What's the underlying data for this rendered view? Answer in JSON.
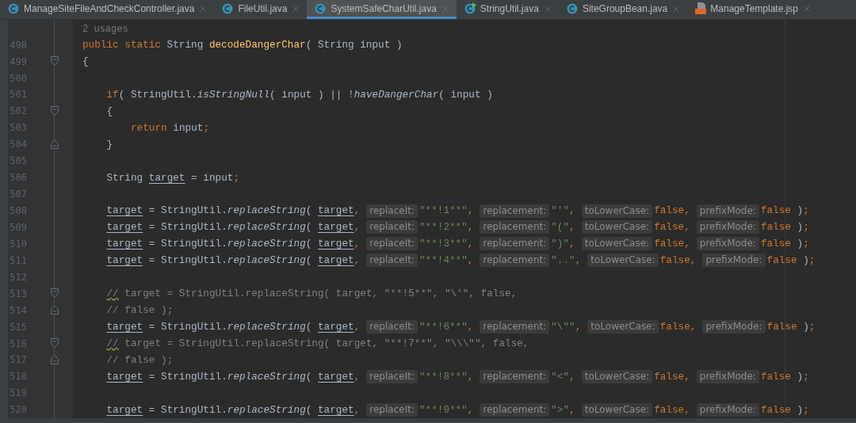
{
  "tabs": [
    {
      "label": "ManageSiteFileAndCheckController.java",
      "kind": "class",
      "selected": false
    },
    {
      "label": "FileUtil.java",
      "kind": "class",
      "selected": false
    },
    {
      "label": "SystemSafeCharUtil.java",
      "kind": "class",
      "selected": true
    },
    {
      "label": "StringUtil.java",
      "kind": "runnable",
      "selected": false
    },
    {
      "label": "SiteGroupBean.java",
      "kind": "class",
      "selected": false
    },
    {
      "label": "ManageTemplate.jsp",
      "kind": "jsp",
      "selected": false
    }
  ],
  "usages": "2 usages",
  "lines": [
    {
      "number": "498",
      "kind": "member",
      "fold_start": false,
      "fold_end": false,
      "tokens": [
        {
          "kind": "keyword",
          "text": "public static "
        },
        {
          "kind": "plain",
          "text": "String "
        },
        {
          "kind": "declaration",
          "text": "decodeDangerChar"
        },
        {
          "kind": "plain",
          "text": "( String input )"
        }
      ]
    },
    {
      "number": "499",
      "kind": "member",
      "fold_start": true,
      "fold_end": false,
      "tokens": [
        {
          "kind": "plain",
          "text": "{"
        }
      ]
    },
    {
      "number": "500",
      "kind": "member",
      "fold_start": false,
      "fold_end": false
    },
    {
      "number": "501",
      "kind": "statement",
      "fold_start": false,
      "fold_end": false,
      "tokens": [
        {
          "kind": "keyword",
          "text": "if"
        },
        {
          "kind": "plain",
          "text": "( StringUtil."
        },
        {
          "kind": "call",
          "text": "isStringNull"
        },
        {
          "kind": "plain",
          "text": "( input ) || !"
        },
        {
          "kind": "call",
          "text": "haveDangerChar"
        },
        {
          "kind": "plain",
          "text": "( input )"
        }
      ]
    },
    {
      "number": "502",
      "kind": "statement",
      "fold_start": true,
      "fold_end": false,
      "tokens": [
        {
          "kind": "plain",
          "text": "{"
        }
      ]
    },
    {
      "number": "503",
      "kind": "inner",
      "fold_start": false,
      "fold_end": false,
      "tokens": [
        {
          "kind": "keyword",
          "text": "return "
        },
        {
          "kind": "plain",
          "text": "input"
        },
        {
          "kind": "keyword",
          "text": ";"
        }
      ]
    },
    {
      "number": "504",
      "kind": "statement",
      "fold_start": false,
      "fold_end": true,
      "tokens": [
        {
          "kind": "plain",
          "text": "}"
        }
      ]
    },
    {
      "number": "505",
      "kind": "member",
      "fold_start": false,
      "fold_end": false
    },
    {
      "number": "506",
      "kind": "statement",
      "fold_start": false,
      "fold_end": false,
      "tokens": [
        {
          "kind": "plain",
          "text": "String "
        },
        {
          "kind": "variable",
          "text": "target"
        },
        {
          "kind": "plain",
          "text": " = input"
        },
        {
          "kind": "keyword",
          "text": ";"
        }
      ]
    },
    {
      "number": "507",
      "kind": "member",
      "fold_start": false,
      "fold_end": false
    },
    {
      "number": "508",
      "kind": "statement",
      "fold_start": false,
      "fold_end": false,
      "tokens": [
        {
          "kind": "variable",
          "text": "target"
        },
        {
          "kind": "plain",
          "text": " = StringUtil."
        },
        {
          "kind": "call",
          "text": "replaceString"
        },
        {
          "kind": "plain",
          "text": "( "
        },
        {
          "kind": "variable",
          "text": "target"
        },
        {
          "kind": "keyword",
          "text": ","
        },
        {
          "kind": "hint",
          "text": "replaceIt:"
        },
        {
          "kind": "string",
          "text": "\"**!1**\""
        },
        {
          "kind": "keyword",
          "text": ","
        },
        {
          "kind": "hint",
          "text": "replacement:"
        },
        {
          "kind": "string",
          "text": "\"'\""
        },
        {
          "kind": "keyword",
          "text": ","
        },
        {
          "kind": "hint",
          "text": "toLowerCase:"
        },
        {
          "kind": "keyword",
          "text": "false,"
        },
        {
          "kind": "hint",
          "text": "prefixMode:"
        },
        {
          "kind": "keyword",
          "text": "false"
        },
        {
          "kind": "plain",
          "text": " )"
        },
        {
          "kind": "keyword",
          "text": ";"
        }
      ]
    },
    {
      "number": "509",
      "kind": "statement",
      "fold_start": false,
      "fold_end": false,
      "tokens": [
        {
          "kind": "variable",
          "text": "target"
        },
        {
          "kind": "plain",
          "text": " = StringUtil."
        },
        {
          "kind": "call",
          "text": "replaceString"
        },
        {
          "kind": "plain",
          "text": "( "
        },
        {
          "kind": "variable",
          "text": "target"
        },
        {
          "kind": "keyword",
          "text": ","
        },
        {
          "kind": "hint",
          "text": "replaceIt:"
        },
        {
          "kind": "string",
          "text": "\"**!2**\""
        },
        {
          "kind": "keyword",
          "text": ","
        },
        {
          "kind": "hint",
          "text": "replacement:"
        },
        {
          "kind": "string",
          "text": "\"(\""
        },
        {
          "kind": "keyword",
          "text": ","
        },
        {
          "kind": "hint",
          "text": "toLowerCase:"
        },
        {
          "kind": "keyword",
          "text": "false,"
        },
        {
          "kind": "hint",
          "text": "prefixMode:"
        },
        {
          "kind": "keyword",
          "text": "false"
        },
        {
          "kind": "plain",
          "text": " )"
        },
        {
          "kind": "keyword",
          "text": ";"
        }
      ]
    },
    {
      "number": "510",
      "kind": "statement",
      "fold_start": false,
      "fold_end": false,
      "tokens": [
        {
          "kind": "variable",
          "text": "target"
        },
        {
          "kind": "plain",
          "text": " = StringUtil."
        },
        {
          "kind": "call",
          "text": "replaceString"
        },
        {
          "kind": "plain",
          "text": "( "
        },
        {
          "kind": "variable",
          "text": "target"
        },
        {
          "kind": "keyword",
          "text": ","
        },
        {
          "kind": "hint",
          "text": "replaceIt:"
        },
        {
          "kind": "string",
          "text": "\"**!3**\""
        },
        {
          "kind": "keyword",
          "text": ","
        },
        {
          "kind": "hint",
          "text": "replacement:"
        },
        {
          "kind": "string",
          "text": "\")\""
        },
        {
          "kind": "keyword",
          "text": ","
        },
        {
          "kind": "hint",
          "text": "toLowerCase:"
        },
        {
          "kind": "keyword",
          "text": "false,"
        },
        {
          "kind": "hint",
          "text": "prefixMode:"
        },
        {
          "kind": "keyword",
          "text": "false"
        },
        {
          "kind": "plain",
          "text": " )"
        },
        {
          "kind": "keyword",
          "text": ";"
        }
      ]
    },
    {
      "number": "511",
      "kind": "statement",
      "fold_start": false,
      "fold_end": false,
      "tokens": [
        {
          "kind": "variable",
          "text": "target"
        },
        {
          "kind": "plain",
          "text": " = StringUtil."
        },
        {
          "kind": "call",
          "text": "replaceString"
        },
        {
          "kind": "plain",
          "text": "( "
        },
        {
          "kind": "variable",
          "text": "target"
        },
        {
          "kind": "keyword",
          "text": ","
        },
        {
          "kind": "hint",
          "text": "replaceIt:"
        },
        {
          "kind": "string",
          "text": "\"**!4**\""
        },
        {
          "kind": "keyword",
          "text": ","
        },
        {
          "kind": "hint",
          "text": "replacement:"
        },
        {
          "kind": "string",
          "text": "\"..\""
        },
        {
          "kind": "keyword",
          "text": ","
        },
        {
          "kind": "hint",
          "text": "toLowerCase:"
        },
        {
          "kind": "keyword",
          "text": "false,"
        },
        {
          "kind": "hint",
          "text": "prefixMode:"
        },
        {
          "kind": "keyword",
          "text": "false"
        },
        {
          "kind": "plain",
          "text": " )"
        },
        {
          "kind": "keyword",
          "text": ";"
        }
      ]
    },
    {
      "number": "512",
      "kind": "member",
      "fold_start": false,
      "fold_end": false
    },
    {
      "number": "513",
      "kind": "statement",
      "fold_start": true,
      "fold_end": false,
      "tokens": [
        {
          "kind": "comment_marked",
          "text": "//"
        },
        {
          "kind": "comment",
          "text": " target = StringUtil.replaceString( target, \"**!5**\", \"\\'\", false,"
        }
      ]
    },
    {
      "number": "514",
      "kind": "statement",
      "fold_start": false,
      "fold_end": true,
      "tokens": [
        {
          "kind": "comment",
          "text": "// false );"
        }
      ]
    },
    {
      "number": "515",
      "kind": "statement",
      "fold_start": false,
      "fold_end": false,
      "tokens": [
        {
          "kind": "variable",
          "text": "target"
        },
        {
          "kind": "plain",
          "text": " = StringUtil."
        },
        {
          "kind": "call",
          "text": "replaceString"
        },
        {
          "kind": "plain",
          "text": "( "
        },
        {
          "kind": "variable",
          "text": "target"
        },
        {
          "kind": "keyword",
          "text": ","
        },
        {
          "kind": "hint",
          "text": "replaceIt:"
        },
        {
          "kind": "string",
          "text": "\"**!6**\""
        },
        {
          "kind": "keyword",
          "text": ","
        },
        {
          "kind": "hint",
          "text": "replacement:"
        },
        {
          "kind": "string",
          "text": "\"\\\"\""
        },
        {
          "kind": "keyword",
          "text": ","
        },
        {
          "kind": "hint",
          "text": "toLowerCase:"
        },
        {
          "kind": "keyword",
          "text": "false,"
        },
        {
          "kind": "hint",
          "text": "prefixMode:"
        },
        {
          "kind": "keyword",
          "text": "false"
        },
        {
          "kind": "plain",
          "text": " )"
        },
        {
          "kind": "keyword",
          "text": ";"
        }
      ]
    },
    {
      "number": "516",
      "kind": "statement",
      "fold_start": true,
      "fold_end": false,
      "tokens": [
        {
          "kind": "comment_marked",
          "text": "//"
        },
        {
          "kind": "comment",
          "text": " target = StringUtil.replaceString( target, \"**!7**\", \"\\\\\\\"\", false,"
        }
      ]
    },
    {
      "number": "517",
      "kind": "statement",
      "fold_start": false,
      "fold_end": true,
      "tokens": [
        {
          "kind": "comment",
          "text": "// false );"
        }
      ]
    },
    {
      "number": "518",
      "kind": "statement",
      "fold_start": false,
      "fold_end": false,
      "tokens": [
        {
          "kind": "variable",
          "text": "target"
        },
        {
          "kind": "plain",
          "text": " = StringUtil."
        },
        {
          "kind": "call",
          "text": "replaceString"
        },
        {
          "kind": "plain",
          "text": "( "
        },
        {
          "kind": "variable",
          "text": "target"
        },
        {
          "kind": "keyword",
          "text": ","
        },
        {
          "kind": "hint",
          "text": "replaceIt:"
        },
        {
          "kind": "string",
          "text": "\"**!8**\""
        },
        {
          "kind": "keyword",
          "text": ","
        },
        {
          "kind": "hint",
          "text": "replacement:"
        },
        {
          "kind": "string",
          "text": "\"<\""
        },
        {
          "kind": "keyword",
          "text": ","
        },
        {
          "kind": "hint",
          "text": "toLowerCase:"
        },
        {
          "kind": "keyword",
          "text": "false,"
        },
        {
          "kind": "hint",
          "text": "prefixMode:"
        },
        {
          "kind": "keyword",
          "text": "false"
        },
        {
          "kind": "plain",
          "text": " )"
        },
        {
          "kind": "keyword",
          "text": ";"
        }
      ]
    },
    {
      "number": "519",
      "kind": "member",
      "fold_start": false,
      "fold_end": false
    },
    {
      "number": "520",
      "kind": "statement",
      "fold_start": false,
      "fold_end": false,
      "tokens": [
        {
          "kind": "variable",
          "text": "target"
        },
        {
          "kind": "plain",
          "text": " = StringUtil."
        },
        {
          "kind": "call",
          "text": "replaceString"
        },
        {
          "kind": "plain",
          "text": "( "
        },
        {
          "kind": "variable",
          "text": "target"
        },
        {
          "kind": "keyword",
          "text": ","
        },
        {
          "kind": "hint",
          "text": "replaceIt:"
        },
        {
          "kind": "string",
          "text": "\"**!9**\""
        },
        {
          "kind": "keyword",
          "text": ","
        },
        {
          "kind": "hint",
          "text": "replacement:"
        },
        {
          "kind": "string",
          "text": "\">\""
        },
        {
          "kind": "keyword",
          "text": ","
        },
        {
          "kind": "hint",
          "text": "toLowerCase:"
        },
        {
          "kind": "keyword",
          "text": "false,"
        },
        {
          "kind": "hint",
          "text": "prefixMode:"
        },
        {
          "kind": "keyword",
          "text": "false"
        },
        {
          "kind": "plain",
          "text": " )"
        },
        {
          "kind": "keyword",
          "text": ";"
        }
      ]
    }
  ]
}
